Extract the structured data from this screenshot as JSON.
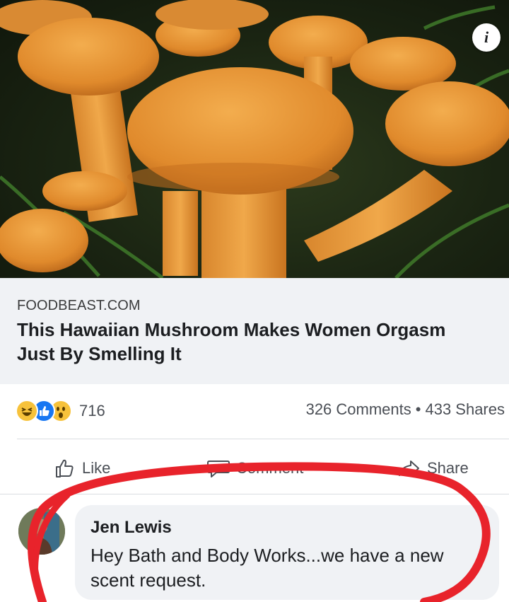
{
  "post": {
    "image_alt": "orange mushrooms",
    "link": {
      "domain": "FOODBEAST.COM",
      "title": "This Hawaiian Mushroom Makes Women Orgasm Just By Smelling It"
    },
    "info_icon": "info-icon"
  },
  "engagement": {
    "reaction_icons": [
      "haha-reaction-icon",
      "like-reaction-icon",
      "wow-reaction-icon"
    ],
    "reaction_count": "716",
    "comments": "326 Comments",
    "separator": "•",
    "shares": "433 Shares"
  },
  "actions": {
    "like": "Like",
    "comment": "Comment",
    "share": "Share"
  },
  "comment": {
    "author": "Jen Lewis",
    "text": "Hey Bath and Body Works...we have a new scent request."
  },
  "colors": {
    "annotation": "#e8232b",
    "mushroom": "#e89a3a",
    "link_bg": "#f0f2f5",
    "like_blue": "#1877f2"
  }
}
